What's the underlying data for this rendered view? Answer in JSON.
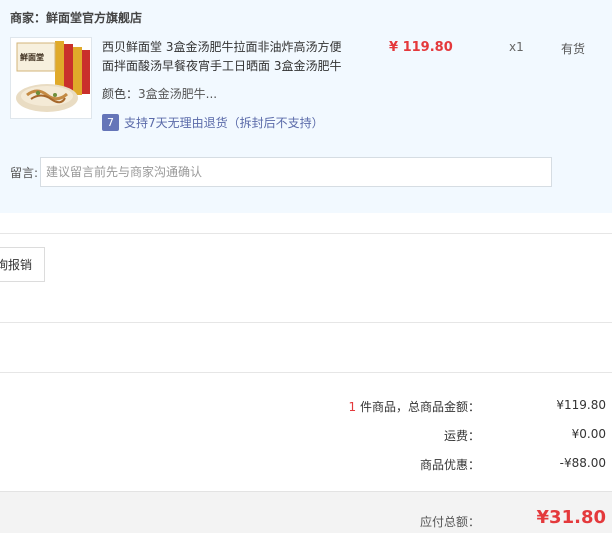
{
  "shop": {
    "label": "商家：",
    "name": "鲜面堂官方旗舰店"
  },
  "product": {
    "title_line1": "西贝鲜面堂 3盒金汤肥牛拉面非油炸高汤方便",
    "title_line2": "面拌面酸汤早餐夜宵手工日晒面 3盒金汤肥牛",
    "color_label": "颜色：",
    "color_value": "3盒金汤肥牛...",
    "return_icon_text": "7",
    "return_policy": "支持7天无理由退货（拆封后不支持）",
    "price": "¥ 119.80",
    "quantity": "x1",
    "stock_status": "有货",
    "thumb_text": "鲜面堂"
  },
  "message": {
    "label": "留言:",
    "placeholder": "建议留言前先与商家沟通确认"
  },
  "invoice_button": {
    "label": "询报销"
  },
  "summary": {
    "item_count": "1",
    "item_count_suffix": " 件商品，总商品金额：",
    "total": "¥119.80",
    "shipping_label": "运费：",
    "shipping": "¥0.00",
    "discount_label": "商品优惠：",
    "discount": "-¥88.00"
  },
  "payable": {
    "label": "应付总额：",
    "amount": "¥31.80"
  },
  "colors": {
    "accent_red": "#e4393c",
    "panel_bg": "#f2f9ff",
    "return_badge": "#6575b8"
  }
}
